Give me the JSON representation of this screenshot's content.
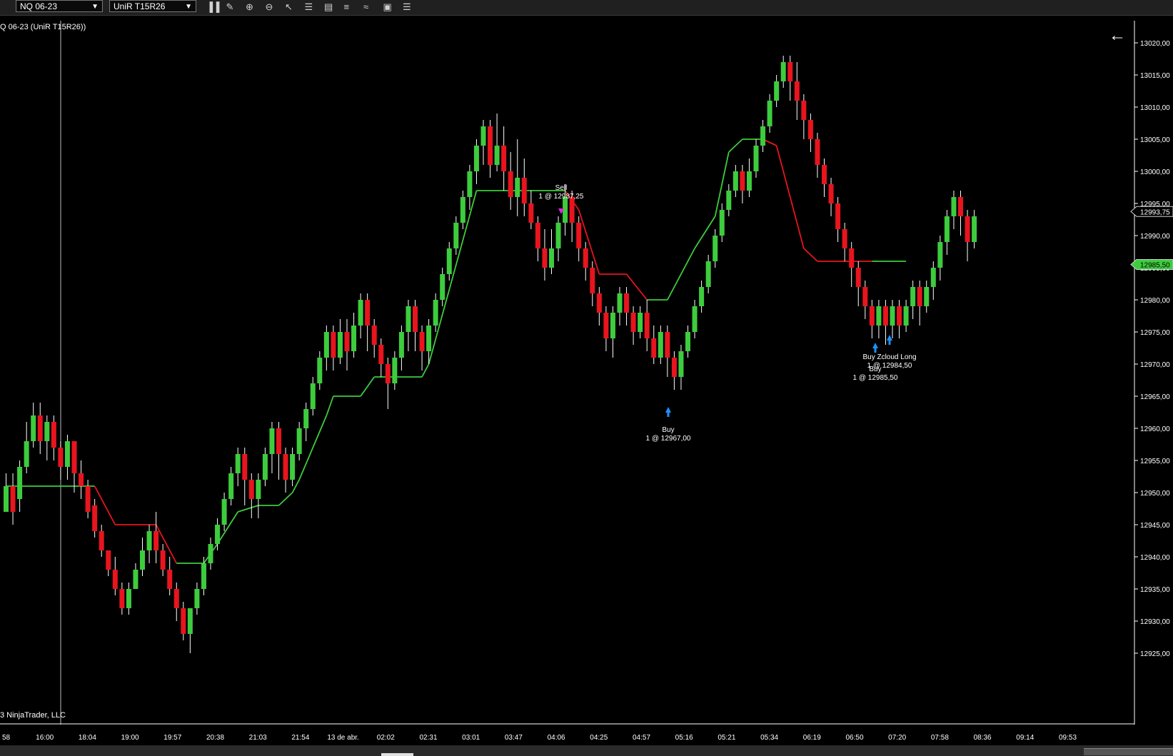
{
  "toolbar": {
    "instrument": "NQ 06-23",
    "bar_type": "UniR T15R26",
    "tools": [
      "bar-chart-icon",
      "pencil-icon",
      "zoom-in-icon",
      "zoom-out-icon",
      "pointer-icon",
      "properties-icon",
      "data-box-icon",
      "indicators-icon",
      "strategies-icon",
      "templates-icon",
      "list-icon"
    ]
  },
  "chart": {
    "label": "Q 06-23 (UniR T15R26))",
    "copyright": "3 NinjaTrader, LLC",
    "colors": {
      "up": "#3dcc3d",
      "down": "#e8141e",
      "trail_up": "#3dcc3d",
      "trail_down": "#e8141e",
      "axis_text": "#ffffff"
    },
    "price_axis": {
      "ticks": [
        "13020,00",
        "13015,00",
        "13010,00",
        "13005,00",
        "13000,00",
        "12995,00",
        "12990,00",
        "12985,00",
        "12980,00",
        "12975,00",
        "12970,00",
        "12965,00",
        "12960,00",
        "12955,00",
        "12950,00",
        "12945,00",
        "12940,00",
        "12935,00",
        "12930,00",
        "12925,00"
      ],
      "last_price": "12993,75",
      "indicator_price": "12985,50"
    },
    "time_axis": [
      "58",
      "16:00",
      "18:04",
      "19:00",
      "19:57",
      "20:38",
      "21:03",
      "21:54",
      "13 de abr.",
      "02:02",
      "02:31",
      "03:01",
      "03:47",
      "04:06",
      "04:25",
      "04:57",
      "05:16",
      "05:21",
      "05:34",
      "06:19",
      "06:50",
      "07:20",
      "07:58",
      "08:36",
      "09:14",
      "09:53"
    ],
    "annotations": [
      {
        "name": "sell-marker",
        "line1": "Sell",
        "line2": "1 @ 12987,25"
      },
      {
        "name": "buy-marker",
        "line1": "Buy",
        "line2": "1 @ 12967,00"
      },
      {
        "name": "zcloud-marker",
        "line1": "Buy Zcloud Long",
        "line2": "1 @ 12984,50"
      },
      {
        "name": "buy-marker-2",
        "line1": "Buy",
        "line2": "1 @ 12985,50"
      }
    ]
  },
  "chart_data": {
    "type": "candlestick",
    "price_range": [
      12921,
      13026
    ],
    "bars": [
      [
        12947,
        12951,
        12949,
        12953
      ],
      [
        12951,
        12947,
        12945,
        12953
      ],
      [
        12949,
        12954,
        12947,
        12955
      ],
      [
        12954,
        12958,
        12953,
        12961
      ],
      [
        12958,
        12962,
        12957,
        12964
      ],
      [
        12962,
        12958,
        12956,
        12964
      ],
      [
        12958,
        12961,
        12955,
        12962
      ],
      [
        12961,
        12957,
        12955,
        12962
      ],
      [
        12957,
        12954,
        12952,
        12958
      ],
      [
        12954,
        12958,
        12952,
        12959
      ],
      [
        12958,
        12953,
        12950,
        12958
      ],
      [
        12953,
        12951,
        12949,
        12955
      ],
      [
        12951,
        12947,
        12946,
        12952
      ],
      [
        12948,
        12944,
        12943,
        12949
      ],
      [
        12944,
        12941,
        12940,
        12945
      ],
      [
        12941,
        12938,
        12937,
        12941
      ],
      [
        12938,
        12935,
        12934,
        12940
      ],
      [
        12935,
        12932,
        12931,
        12936
      ],
      [
        12932,
        12935,
        12931,
        12936
      ],
      [
        12935,
        12938,
        12935,
        12939
      ],
      [
        12938,
        12941,
        12937,
        12943
      ],
      [
        12941,
        12944,
        12939,
        12945
      ],
      [
        12944,
        12941,
        12939,
        12947
      ],
      [
        12941,
        12938,
        12937,
        12942
      ],
      [
        12938,
        12935,
        12934,
        12940
      ],
      [
        12935,
        12932,
        12930,
        12936
      ],
      [
        12932,
        12928,
        12927,
        12933
      ],
      [
        12928,
        12932,
        12925,
        12932
      ],
      [
        12932,
        12935,
        12931,
        12936
      ],
      [
        12935,
        12939,
        12934,
        12940
      ],
      [
        12939,
        12942,
        12938,
        12943
      ],
      [
        12942,
        12945,
        12941,
        12946
      ],
      [
        12945,
        12949,
        12944,
        12950
      ],
      [
        12949,
        12953,
        12948,
        12954
      ],
      [
        12953,
        12956,
        12951,
        12957
      ],
      [
        12956,
        12952,
        12948,
        12957
      ],
      [
        12952,
        12949,
        12946,
        12953
      ],
      [
        12949,
        12952,
        12946,
        12953
      ],
      [
        12952,
        12956,
        12951,
        12957
      ],
      [
        12956,
        12960,
        12953,
        12961
      ],
      [
        12960,
        12956,
        12952,
        12961
      ],
      [
        12956,
        12952,
        12950,
        12957
      ],
      [
        12952,
        12956,
        12951,
        12957
      ],
      [
        12956,
        12960,
        12955,
        12961
      ],
      [
        12960,
        12963,
        12958,
        12964
      ],
      [
        12963,
        12967,
        12962,
        12968
      ],
      [
        12967,
        12971,
        12966,
        12972
      ],
      [
        12971,
        12975,
        12969,
        12976
      ],
      [
        12975,
        12971,
        12969,
        12976
      ],
      [
        12971,
        12975,
        12970,
        12977
      ],
      [
        12975,
        12972,
        12969,
        12977
      ],
      [
        12972,
        12976,
        12971,
        12978
      ],
      [
        12976,
        12980,
        12974,
        12981
      ],
      [
        12980,
        12976,
        12972,
        12981
      ],
      [
        12976,
        12973,
        12971,
        12977
      ],
      [
        12973,
        12970,
        12968,
        12974
      ],
      [
        12970,
        12967,
        12963,
        12971
      ],
      [
        12967,
        12971,
        12966,
        12972
      ],
      [
        12971,
        12975,
        12969,
        12976
      ],
      [
        12975,
        12979,
        12972,
        12980
      ],
      [
        12979,
        12975,
        12972,
        12980
      ],
      [
        12975,
        12972,
        12969,
        12976
      ],
      [
        12972,
        12976,
        12970,
        12977
      ],
      [
        12976,
        12980,
        12975,
        12981
      ],
      [
        12980,
        12984,
        12979,
        12985
      ],
      [
        12984,
        12988,
        12983,
        12989
      ],
      [
        12988,
        12992,
        12987,
        12993
      ],
      [
        12992,
        12996,
        12991,
        12997
      ],
      [
        12996,
        13000,
        12994,
        13001
      ],
      [
        13000,
        13004,
        12998,
        13005
      ],
      [
        13004,
        13007,
        13001,
        13008
      ],
      [
        13007,
        13001,
        12999,
        13008
      ],
      [
        13001,
        13004,
        13000,
        13009
      ],
      [
        13004,
        13000,
        12997,
        13007
      ],
      [
        13000,
        12996,
        12994,
        13003
      ],
      [
        12996,
        12999,
        12993,
        13005
      ],
      [
        12999,
        12995,
        12993,
        13002
      ],
      [
        12995,
        12992,
        12991,
        12997
      ],
      [
        12992,
        12988,
        12986,
        12993
      ],
      [
        12988,
        12985,
        12983,
        12991
      ],
      [
        12985,
        12988,
        12984,
        12991
      ],
      [
        12988,
        12992,
        12986,
        12993
      ],
      [
        12992,
        12996,
        12990,
        12998
      ],
      [
        12996,
        12992,
        12989,
        12997
      ],
      [
        12992,
        12988,
        12986,
        12993
      ],
      [
        12988,
        12985,
        12983,
        12989
      ],
      [
        12985,
        12981,
        12979,
        12986
      ],
      [
        12981,
        12978,
        12976,
        12982
      ],
      [
        12978,
        12974,
        12972,
        12979
      ],
      [
        12974,
        12978,
        12971,
        12979
      ],
      [
        12978,
        12981,
        12976,
        12982
      ],
      [
        12981,
        12978,
        12976,
        12982
      ],
      [
        12978,
        12975,
        12973,
        12979
      ],
      [
        12975,
        12978,
        12974,
        12979
      ],
      [
        12978,
        12974,
        12972,
        12980
      ],
      [
        12974,
        12971,
        12970,
        12976
      ],
      [
        12971,
        12975,
        12970,
        12976
      ],
      [
        12975,
        12971,
        12968,
        12976
      ],
      [
        12971,
        12968,
        12966,
        12972
      ],
      [
        12968,
        12972,
        12966,
        12973
      ],
      [
        12972,
        12975,
        12971,
        12976
      ],
      [
        12975,
        12979,
        12974,
        12980
      ],
      [
        12979,
        12982,
        12978,
        12983
      ],
      [
        12982,
        12986,
        12981,
        12987
      ],
      [
        12986,
        12990,
        12985,
        12991
      ],
      [
        12990,
        12994,
        12989,
        12995
      ],
      [
        12994,
        12997,
        12993,
        12998
      ],
      [
        12997,
        13000,
        12996,
        13001
      ],
      [
        13000,
        12997,
        12995,
        13001
      ],
      [
        12997,
        13000,
        12996,
        13002
      ],
      [
        13000,
        13004,
        12999,
        13005
      ],
      [
        13004,
        13007,
        13003,
        13008
      ],
      [
        13007,
        13011,
        13006,
        13012
      ],
      [
        13011,
        13014,
        13010,
        13015
      ],
      [
        13014,
        13017,
        13013,
        13018
      ],
      [
        13017,
        13014,
        13011,
        13018
      ],
      [
        13014,
        13011,
        13008,
        13017
      ],
      [
        13011,
        13008,
        13005,
        13012
      ],
      [
        13008,
        13005,
        13003,
        13009
      ],
      [
        13005,
        13001,
        12999,
        13006
      ],
      [
        13001,
        12998,
        12996,
        13002
      ],
      [
        12998,
        12995,
        12993,
        12999
      ],
      [
        12995,
        12991,
        12989,
        12996
      ],
      [
        12991,
        12988,
        12986,
        12992
      ],
      [
        12988,
        12985,
        12982,
        12989
      ],
      [
        12985,
        12982,
        12979,
        12986
      ],
      [
        12982,
        12979,
        12977,
        12983
      ],
      [
        12979,
        12976,
        12974,
        12980
      ],
      [
        12976,
        12979,
        12974,
        12980
      ],
      [
        12979,
        12976,
        12973,
        12980
      ],
      [
        12976,
        12979,
        12974,
        12980
      ],
      [
        12979,
        12976,
        12974,
        12980
      ],
      [
        12976,
        12979,
        12975,
        12980
      ],
      [
        12979,
        12982,
        12977,
        12983
      ],
      [
        12982,
        12979,
        12976,
        12983
      ],
      [
        12979,
        12982,
        12978,
        12983
      ],
      [
        12982,
        12985,
        12980,
        12986
      ],
      [
        12985,
        12989,
        12983,
        12990
      ],
      [
        12989,
        12993,
        12987,
        12994
      ],
      [
        12993,
        12996,
        12991,
        12997
      ],
      [
        12996,
        12993,
        12990,
        12997
      ],
      [
        12993,
        12989,
        12986,
        12994
      ],
      [
        12989,
        12993,
        12988,
        12994
      ]
    ],
    "trail": [
      [
        0,
        12951,
        "up"
      ],
      [
        13,
        12951,
        "up"
      ],
      [
        16,
        12945,
        "down"
      ],
      [
        22,
        12945,
        "down"
      ],
      [
        25,
        12939,
        "down"
      ],
      [
        27,
        12939,
        "up"
      ],
      [
        29,
        12939,
        "up"
      ],
      [
        31,
        12942,
        "up"
      ],
      [
        34,
        12947,
        "up"
      ],
      [
        37,
        12948,
        "up"
      ],
      [
        40,
        12948,
        "up"
      ],
      [
        42,
        12950,
        "up"
      ],
      [
        43,
        12952,
        "up"
      ],
      [
        47,
        12962,
        "up"
      ],
      [
        48,
        12965,
        "up"
      ],
      [
        52,
        12965,
        "up"
      ],
      [
        54,
        12968,
        "up"
      ],
      [
        61,
        12968,
        "up"
      ],
      [
        62,
        12970,
        "up"
      ],
      [
        69,
        12997,
        "up"
      ],
      [
        82,
        12997,
        "up"
      ],
      [
        84,
        12994,
        "down"
      ],
      [
        87,
        12984,
        "down"
      ],
      [
        91,
        12984,
        "down"
      ],
      [
        94,
        12980,
        "down"
      ],
      [
        97,
        12980,
        "up"
      ],
      [
        101,
        12988,
        "up"
      ],
      [
        104,
        12993,
        "up"
      ],
      [
        106,
        13003,
        "up"
      ],
      [
        108,
        13005,
        "up"
      ],
      [
        111,
        13005,
        "up"
      ],
      [
        113,
        13004,
        "down"
      ],
      [
        117,
        12988,
        "down"
      ],
      [
        119,
        12986,
        "down"
      ],
      [
        127,
        12986,
        "down"
      ],
      [
        128,
        12986,
        "up"
      ],
      [
        132,
        12986,
        "up"
      ]
    ]
  }
}
